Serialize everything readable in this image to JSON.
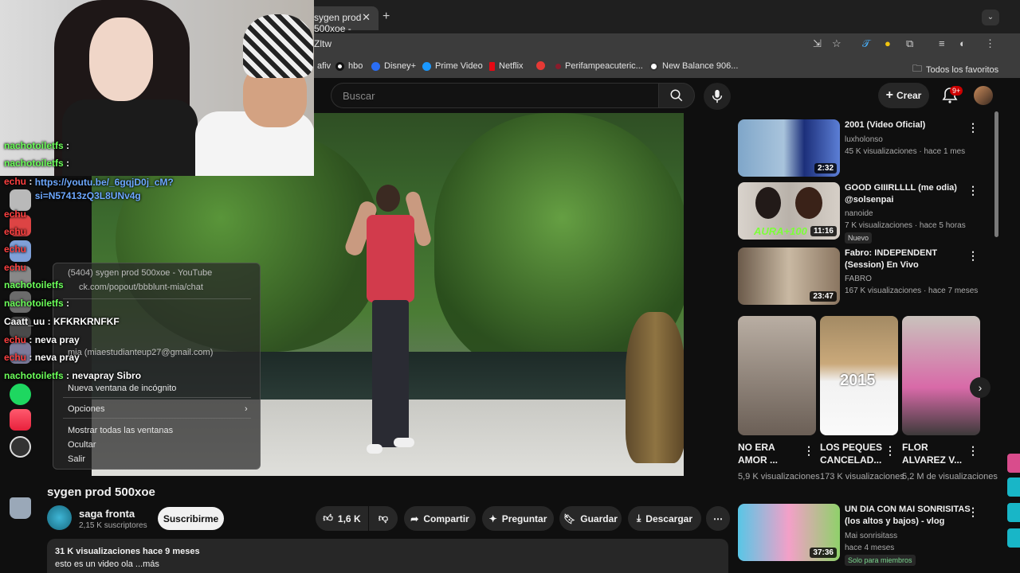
{
  "browser": {
    "tab_title": "sygen prod 500xoe -",
    "address_fragment": "Zltw",
    "bookmarks": [
      {
        "label": "afiv",
        "color": "#e44"
      },
      {
        "label": "hbo",
        "color": "#ffffff"
      },
      {
        "label": "Disney+",
        "color": "#2a6df4"
      },
      {
        "label": "Prime Video",
        "color": "#1a98ff"
      },
      {
        "label": "Netflix",
        "color": "#e50914"
      },
      {
        "label": "",
        "color": "#e53935"
      },
      {
        "label": "Perifampeacuteric...",
        "color": "#8a1c2c"
      },
      {
        "label": "New Balance 906...",
        "color": "#ffffff"
      }
    ],
    "all_bookmarks": "Todos los favoritos"
  },
  "youtube": {
    "search_placeholder": "Buscar",
    "create_label": "Crear",
    "notif_badge": "9+"
  },
  "video": {
    "title": "sygen prod 500xoe",
    "channel": "saga fronta",
    "subscribers": "2,15 K suscriptores",
    "subscribe_label": "Suscribirme",
    "likes": "1,6 K",
    "share_label": "Compartir",
    "ask_label": "Preguntar",
    "save_label": "Guardar",
    "download_label": "Descargar",
    "views_date": "31 K visualizaciones  hace 9 meses",
    "description": "esto es un video ola ...más"
  },
  "recommendations": [
    {
      "title": "2001 (Video Oficial)",
      "channel": "luxholonso",
      "meta": "45 K visualizaciones · hace 1 mes",
      "duration": "2:32",
      "tag": ""
    },
    {
      "title": "GOOD GIIIRLLLL (me odia) @solsenpai",
      "channel": "nanoide",
      "meta": "7 K visualizaciones · hace 5 horas",
      "duration": "11:16",
      "tag": "Nuevo"
    },
    {
      "title": "Fabro:  INDEPENDENT (Session) En Vivo",
      "channel": "FABRO",
      "meta": "167 K visualizaciones · hace 7 meses",
      "duration": "23:47",
      "tag": ""
    },
    {
      "title": "UN DIA CON MAI SONRISITAS (los altos y bajos) - vlog",
      "channel": "Mai sonrisitass",
      "meta": "hace 4 meses",
      "duration": "37:36",
      "tag": "Solo para miembros"
    }
  ],
  "shorts": [
    {
      "title": "NO ERA AMOR ...",
      "views": "5,9 K visualizaciones"
    },
    {
      "title": "LOS PEQUES CANCELAD...",
      "views": "173 K visualizaciones"
    },
    {
      "title": "FLOR ALVAREZ V...",
      "views": "5,2 M de visualizaciones"
    }
  ],
  "shorts_overlay_text": "2015",
  "chat": [
    {
      "user": "nachotoiletfs",
      "text": "",
      "user_color": "green"
    },
    {
      "user": "nachotoiletfs",
      "text": "",
      "user_color": "green"
    },
    {
      "user": "echu",
      "text": "https://youtu.be/_6gqjD0j_cM?si=N57413zQ3L8UNv4g",
      "user_color": "red"
    },
    {
      "user": "echu",
      "text": "",
      "user_color": "red"
    },
    {
      "user": "echu",
      "text": "",
      "user_color": "red"
    },
    {
      "user": "echu",
      "text": "",
      "user_color": "red"
    },
    {
      "user": "echu",
      "text": "",
      "user_color": "red"
    },
    {
      "user": "nachotoiletfs",
      "text": "",
      "user_color": "green"
    },
    {
      "user": "nachotoiletfs",
      "text": "",
      "user_color": "green"
    },
    {
      "user": "Caatt_uu",
      "text": "KFKRKRNFKF",
      "user_color": "white"
    },
    {
      "user": "echu",
      "text": "neva pray",
      "user_color": "red"
    },
    {
      "user": "echu",
      "text": "neva pray",
      "user_color": "red"
    },
    {
      "user": "nachotoiletfs",
      "text": "nevapray Sibro",
      "user_color": "green"
    }
  ],
  "context_menu": {
    "window_item": "(5404) sygen prod 500xoe - YouTube",
    "url_item": "ck.com/popout/bbblunt-mia/chat",
    "profile_item": "mia (miaestudianteup27@gmail.com)",
    "incognito": "Nueva ventana de incógnito",
    "options": "Opciones",
    "show_all": "Mostrar todas las ventanas",
    "hide": "Ocultar",
    "quit": "Salir"
  }
}
